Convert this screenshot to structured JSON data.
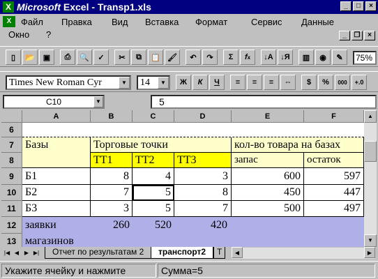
{
  "window": {
    "app_name": "Microsoft",
    "title_rest": "Excel - Transp1.xls"
  },
  "menu": [
    "Файл",
    "Правка",
    "Вид",
    "Вставка",
    "Формат",
    "Сервис",
    "Данные",
    "Окно",
    "?"
  ],
  "format_toolbar": {
    "font": "Times New Roman Cyr",
    "size": "14",
    "bold": "Ж",
    "italic": "К",
    "underline": "Ч",
    "percent": "%",
    "thousands": "000"
  },
  "zoom": "75%",
  "formula_bar": {
    "name_box": "C10",
    "value": "5"
  },
  "columns": [
    "A",
    "B",
    "C",
    "D",
    "E",
    "F"
  ],
  "rows": [
    "6",
    "7",
    "8",
    "9",
    "10",
    "11",
    "12",
    "13"
  ],
  "cells": {
    "A7": "Базы",
    "B7": "Торговые точки",
    "E7": "кол-во товара на базах",
    "B8": "ТТ1",
    "C8": "ТТ2",
    "D8": "ТТ3",
    "E8": "запас",
    "F8": "остаток",
    "A9": "Б1",
    "B9": "8",
    "C9": "4",
    "D9": "3",
    "E9": "600",
    "F9": "597",
    "A10": "Б2",
    "B10": "7",
    "C10": "5",
    "D10": "8",
    "E10": "450",
    "F10": "447",
    "A11": "Б3",
    "B11": "3",
    "C11": "5",
    "D11": "7",
    "E11": "500",
    "F11": "497",
    "A12": "заявки",
    "B12": "260",
    "C12": "520",
    "D12": "420",
    "A13": "магазинов"
  },
  "sheet_tabs": [
    "Отчет по результатам 2",
    "транспорт2",
    "Т"
  ],
  "status": {
    "message": "Укажите ячейку и нажмите",
    "sum": "Сумма=5"
  }
}
